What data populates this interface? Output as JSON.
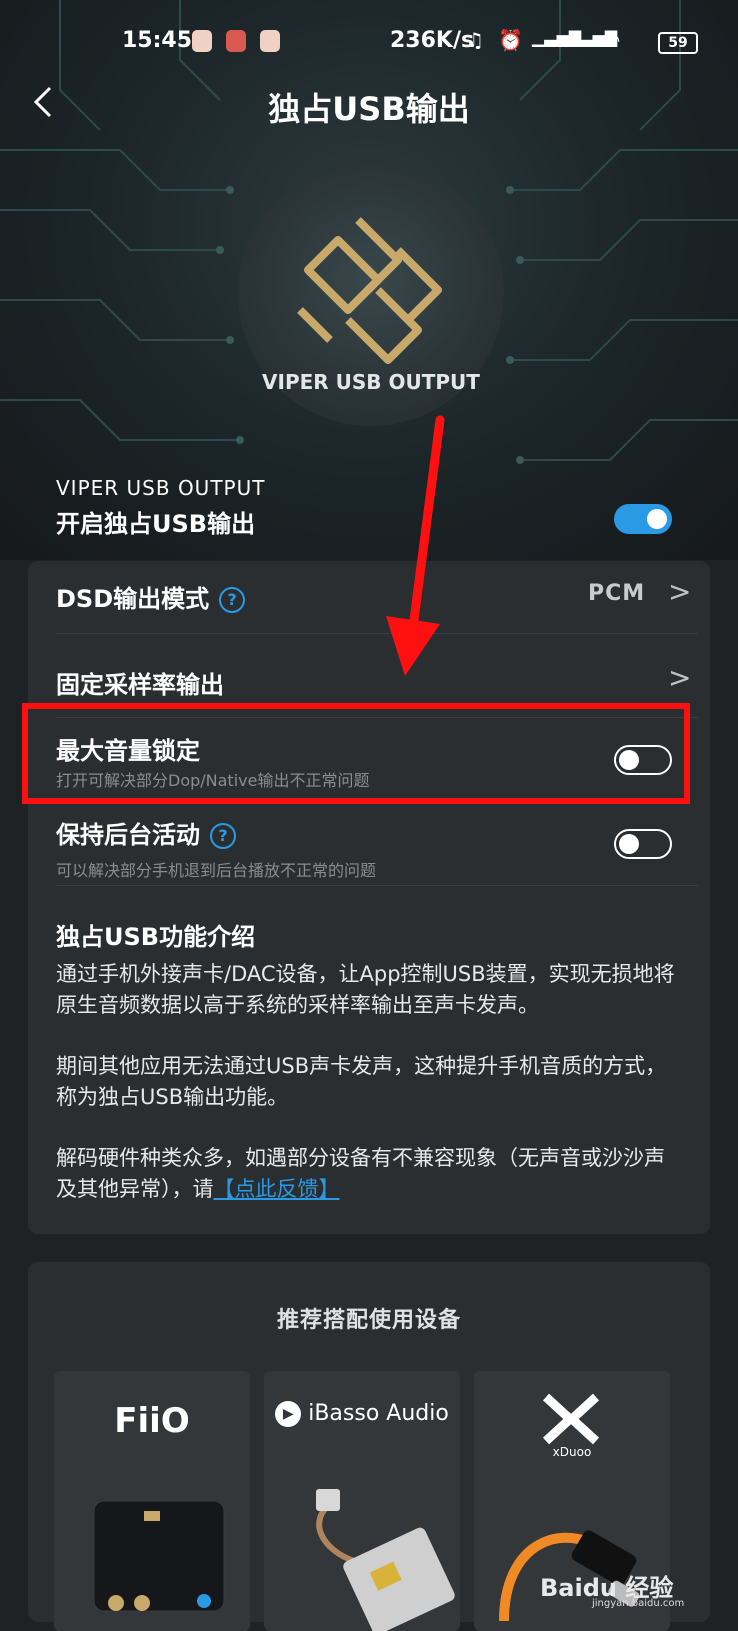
{
  "status_bar": {
    "time": "15:45",
    "net_speed": "236K/s",
    "battery": "59"
  },
  "header": {
    "back_icon": "back-chevron-icon",
    "title": "独占USB输出"
  },
  "hero": {
    "logo_text": "VIPER USB OUTPUT"
  },
  "master_toggle": {
    "caption": "VIPER USB OUTPUT",
    "label": "开启独占USB输出",
    "on": true
  },
  "settings": {
    "dsd_mode": {
      "label": "DSD输出模式",
      "help": "?",
      "value": "PCM",
      "chevron": ">"
    },
    "fixed_rate": {
      "label": "固定采样率输出",
      "chevron": ">"
    },
    "max_volume_lock": {
      "label": "最大音量锁定",
      "sub": "打开可解决部分Dop/Native输出不正常问题",
      "on": false
    },
    "keep_background": {
      "label": "保持后台活动",
      "help": "?",
      "sub": "可以解决部分手机退到后台播放不正常的问题",
      "on": false
    }
  },
  "intro": {
    "title": "独占USB功能介绍",
    "p1": "通过手机外接声卡/DAC设备，让App控制USB装置，实现无损地将原生音频数据以高于系统的采样率输出至声卡发声。",
    "p2": "期间其他应用无法通过USB声卡发声，这种提升手机音质的方式，称为独占USB输出功能。",
    "p3": "解码硬件种类众多，如遇部分设备有不兼容现象（无声音或沙沙声及其他异常），请",
    "feedback_link": "【点此反馈】"
  },
  "recommended": {
    "title": "推荐搭配使用设备",
    "devices": [
      {
        "brand": "FiiO"
      },
      {
        "brand": "iBasso Audio"
      },
      {
        "brand": "xDuoo"
      }
    ]
  },
  "watermark": {
    "text": "Baidu 经验",
    "sub": "jingyan.baidu.com"
  },
  "colors": {
    "accent": "#2a9ae5",
    "highlight": "#ff1010",
    "gold": "#c8a96a"
  }
}
